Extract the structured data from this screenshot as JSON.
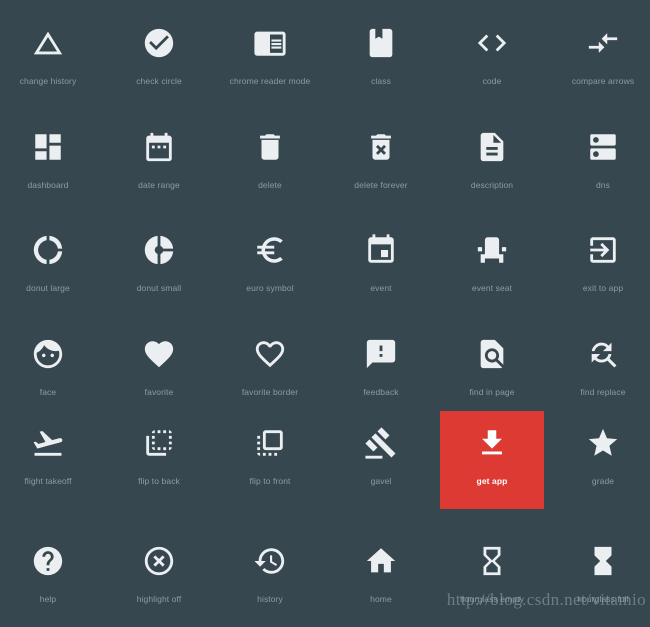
{
  "page": {
    "background_color": "#37474F",
    "label_color": "#8D9BA3",
    "icon_color": "#ECEFF1",
    "highlight_color": "#DD3A33",
    "columns": 6,
    "rows": 6
  },
  "watermark": {
    "text": "http://blog.csdn.net/vitamio"
  },
  "icons": [
    {
      "label": "change history",
      "icon": "change-history-icon",
      "row": 0,
      "col": 0,
      "highlighted": false
    },
    {
      "label": "check circle",
      "icon": "check-circle-icon",
      "row": 0,
      "col": 1,
      "highlighted": false
    },
    {
      "label": "chrome reader mode",
      "icon": "chrome-reader-mode-icon",
      "row": 0,
      "col": 2,
      "highlighted": false
    },
    {
      "label": "class",
      "icon": "class-icon",
      "row": 0,
      "col": 3,
      "highlighted": false
    },
    {
      "label": "code",
      "icon": "code-icon",
      "row": 0,
      "col": 4,
      "highlighted": false
    },
    {
      "label": "compare arrows",
      "icon": "compare-arrows-icon",
      "row": 0,
      "col": 5,
      "highlighted": false
    },
    {
      "label": "dashboard",
      "icon": "dashboard-icon",
      "row": 1,
      "col": 0,
      "highlighted": false
    },
    {
      "label": "date range",
      "icon": "date-range-icon",
      "row": 1,
      "col": 1,
      "highlighted": false
    },
    {
      "label": "delete",
      "icon": "delete-icon",
      "row": 1,
      "col": 2,
      "highlighted": false
    },
    {
      "label": "delete forever",
      "icon": "delete-forever-icon",
      "row": 1,
      "col": 3,
      "highlighted": false
    },
    {
      "label": "description",
      "icon": "description-icon",
      "row": 1,
      "col": 4,
      "highlighted": false
    },
    {
      "label": "dns",
      "icon": "dns-icon",
      "row": 1,
      "col": 5,
      "highlighted": false
    },
    {
      "label": "donut large",
      "icon": "donut-large-icon",
      "row": 2,
      "col": 0,
      "highlighted": false
    },
    {
      "label": "donut small",
      "icon": "donut-small-icon",
      "row": 2,
      "col": 1,
      "highlighted": false
    },
    {
      "label": "euro symbol",
      "icon": "euro-symbol-icon",
      "row": 2,
      "col": 2,
      "highlighted": false
    },
    {
      "label": "event",
      "icon": "event-icon",
      "row": 2,
      "col": 3,
      "highlighted": false
    },
    {
      "label": "event seat",
      "icon": "event-seat-icon",
      "row": 2,
      "col": 4,
      "highlighted": false
    },
    {
      "label": "exit to app",
      "icon": "exit-to-app-icon",
      "row": 2,
      "col": 5,
      "highlighted": false
    },
    {
      "label": "face",
      "icon": "face-icon",
      "row": 3,
      "col": 0,
      "highlighted": false
    },
    {
      "label": "favorite",
      "icon": "favorite-icon",
      "row": 3,
      "col": 1,
      "highlighted": false
    },
    {
      "label": "favorite border",
      "icon": "favorite-border-icon",
      "row": 3,
      "col": 2,
      "highlighted": false
    },
    {
      "label": "feedback",
      "icon": "feedback-icon",
      "row": 3,
      "col": 3,
      "highlighted": false
    },
    {
      "label": "find in page",
      "icon": "find-in-page-icon",
      "row": 3,
      "col": 4,
      "highlighted": false
    },
    {
      "label": "find replace",
      "icon": "find-replace-icon",
      "row": 3,
      "col": 5,
      "highlighted": false
    },
    {
      "label": "flight takeoff",
      "icon": "flight-takeoff-icon",
      "row": 4,
      "col": 0,
      "highlighted": false
    },
    {
      "label": "flip to back",
      "icon": "flip-to-back-icon",
      "row": 4,
      "col": 1,
      "highlighted": false
    },
    {
      "label": "flip to front",
      "icon": "flip-to-front-icon",
      "row": 4,
      "col": 2,
      "highlighted": false
    },
    {
      "label": "gavel",
      "icon": "gavel-icon",
      "row": 4,
      "col": 3,
      "highlighted": false
    },
    {
      "label": "get app",
      "icon": "get-app-icon",
      "row": 4,
      "col": 4,
      "highlighted": true
    },
    {
      "label": "grade",
      "icon": "grade-icon",
      "row": 4,
      "col": 5,
      "highlighted": false
    },
    {
      "label": "help",
      "icon": "help-icon",
      "row": 5,
      "col": 0,
      "highlighted": false
    },
    {
      "label": "highlight off",
      "icon": "highlight-off-icon",
      "row": 5,
      "col": 1,
      "highlighted": false
    },
    {
      "label": "history",
      "icon": "history-icon",
      "row": 5,
      "col": 2,
      "highlighted": false
    },
    {
      "label": "home",
      "icon": "home-icon",
      "row": 5,
      "col": 3,
      "highlighted": false
    },
    {
      "label": "hourglass empty",
      "icon": "hourglass-empty-icon",
      "row": 5,
      "col": 4,
      "highlighted": false
    },
    {
      "label": "hourglass full",
      "icon": "hourglass-full-icon",
      "row": 5,
      "col": 5,
      "highlighted": false
    }
  ]
}
